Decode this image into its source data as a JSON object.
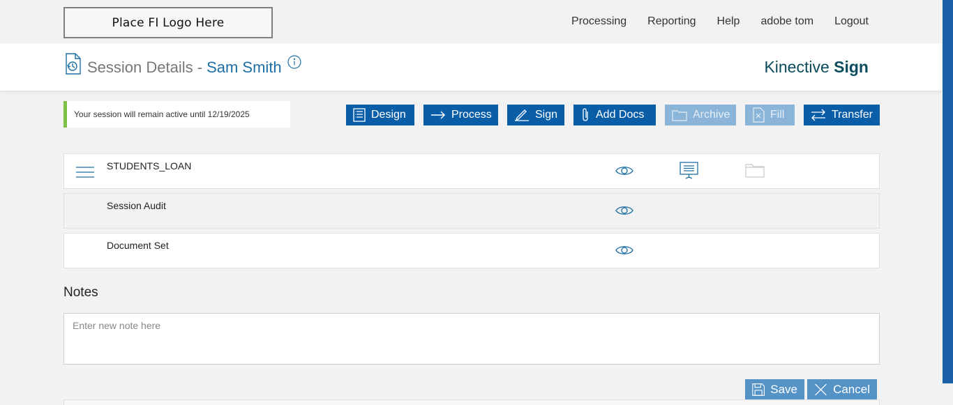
{
  "topbar": {
    "logo_text": "Place FI Logo Here",
    "nav": [
      "Processing",
      "Reporting",
      "Help",
      "adobe tom",
      "Logout"
    ]
  },
  "header": {
    "title": "Session Details -",
    "name": "Sam Smith",
    "brand_light": "Kinective ",
    "brand_bold": "Sign"
  },
  "session_note": "Your session will remain active until 12/19/2025",
  "toolbar": {
    "design": "Design",
    "process": "Process",
    "sign": "Sign",
    "add_docs": "Add Docs",
    "archive": "Archive",
    "fill": "Fill",
    "transfer": "Transfer"
  },
  "rows": [
    {
      "label": "STUDENTS_LOAN"
    },
    {
      "label": "Session Audit"
    },
    {
      "label": "Document Set"
    }
  ],
  "notes": {
    "title": "Notes",
    "placeholder": "Enter new note here",
    "save": "Save",
    "cancel": "Cancel"
  },
  "colors": {
    "accent": "#0a5ea8",
    "accent_disabled": "#8ab4d8",
    "session_bar": "#7cc142",
    "name_blue": "#1c6ea4",
    "brand": "#0c4b5c"
  },
  "icons": [
    "history-document-icon",
    "info-icon",
    "list-icon",
    "arrow-right-icon",
    "pen-icon",
    "paperclip-icon",
    "folder-icon",
    "form-icon",
    "swap-icon",
    "menu-icon",
    "eye-icon",
    "presentation-icon",
    "save-icon",
    "close-icon"
  ]
}
